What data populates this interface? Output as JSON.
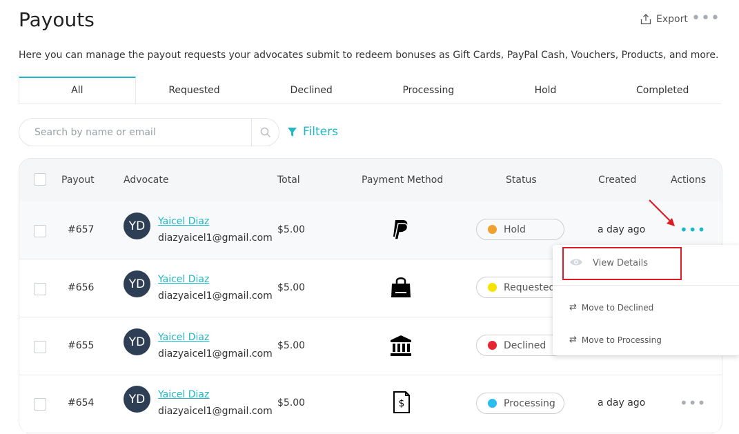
{
  "header": {
    "title": "Payouts",
    "export_label": "Export",
    "description": "Here you can manage the payout requests your advocates submit to redeem bonuses as Gift Cards, PayPal Cash, Vouchers, Products, and more."
  },
  "tabs": [
    {
      "label": "All",
      "active": true
    },
    {
      "label": "Requested"
    },
    {
      "label": "Declined"
    },
    {
      "label": "Processing"
    },
    {
      "label": "Hold"
    },
    {
      "label": "Completed"
    }
  ],
  "search": {
    "placeholder": "Search by name or email"
  },
  "filters_label": "Filters",
  "table": {
    "headers": {
      "payout": "Payout",
      "advocate": "Advocate",
      "total": "Total",
      "payment_method": "Payment Method",
      "status": "Status",
      "created": "Created",
      "actions": "Actions"
    },
    "rows": [
      {
        "payout": "#657",
        "initials": "YD",
        "name": "Yaicel Diaz",
        "email": "diazyaicel1@gmail.com",
        "total": "$5.00",
        "method_icon": "paypal-icon",
        "status": "Hold",
        "status_color": "#f0a12f",
        "created": "a day ago"
      },
      {
        "payout": "#656",
        "initials": "YD",
        "name": "Yaicel Diaz",
        "email": "diazyaicel1@gmail.com",
        "total": "$5.00",
        "method_icon": "shopping-bag-icon",
        "status": "Requested",
        "status_color": "#f5e400",
        "created": ""
      },
      {
        "payout": "#655",
        "initials": "YD",
        "name": "Yaicel Diaz",
        "email": "diazyaicel1@gmail.com",
        "total": "$5.00",
        "method_icon": "bank-icon",
        "status": "Declined",
        "status_color": "#e62531",
        "created": ""
      },
      {
        "payout": "#654",
        "initials": "YD",
        "name": "Yaicel Diaz",
        "email": "diazyaicel1@gmail.com",
        "total": "$5.00",
        "method_icon": "invoice-dollar-icon",
        "status": "Processing",
        "status_color": "#2bbdf0",
        "created": "a day ago"
      }
    ]
  },
  "dropdown": {
    "view_details": "View Details",
    "move_declined": "Move to Declined",
    "move_processing": "Move to Processing"
  },
  "colors": {
    "accent": "#20b7c6",
    "annotation": "#e01a22"
  }
}
